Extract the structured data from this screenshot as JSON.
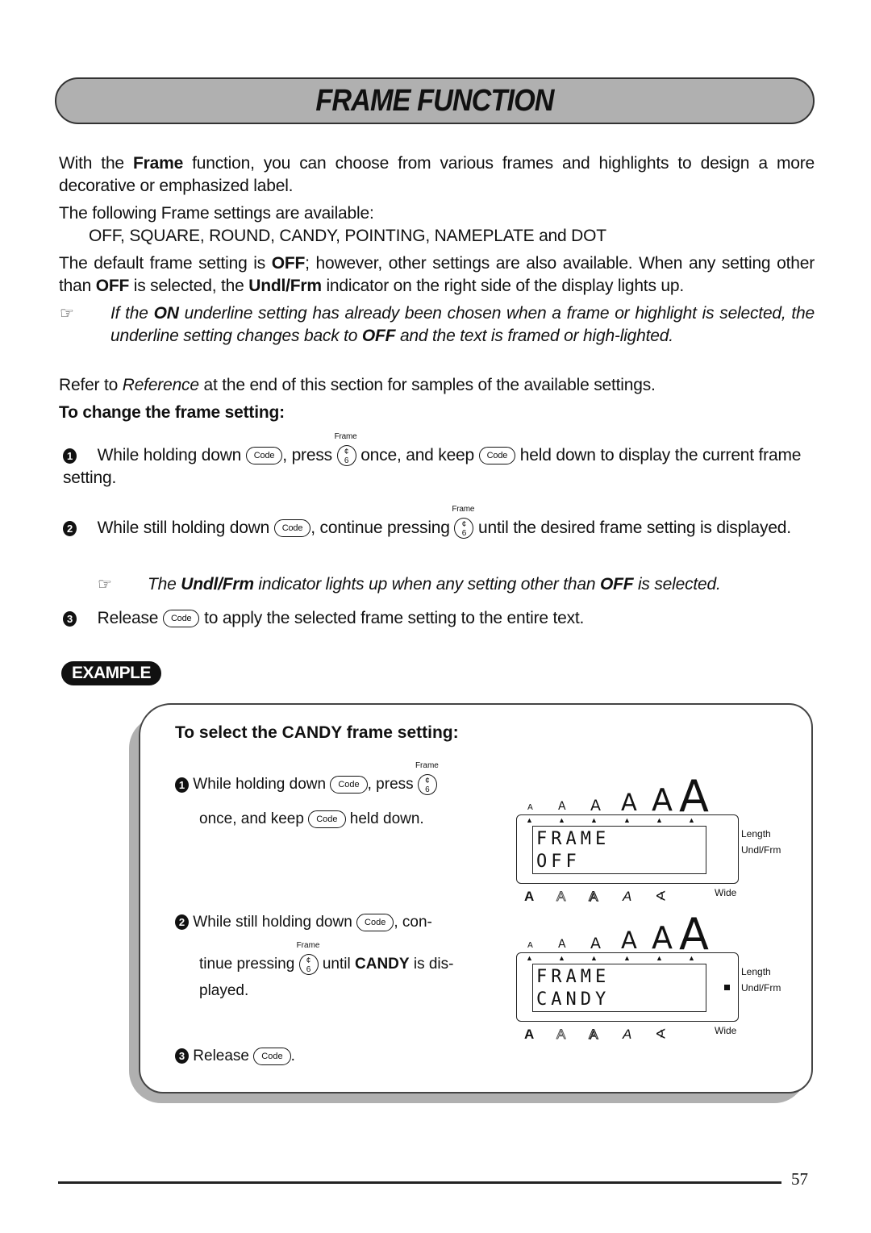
{
  "title": "FRAME FUNCTION",
  "intro": {
    "p1_a": "With the ",
    "p1_bold": "Frame",
    "p1_b": " function, you can choose from various frames and highlights to design a more decorative or emphasized label.",
    "p2": "The following Frame settings are available:",
    "settings_list": "OFF, SQUARE, ROUND, CANDY, POINTING, NAMEPLATE and DOT",
    "p3_a": "The default frame setting is ",
    "p3_off": "OFF",
    "p3_b": "; however, other settings are also available. When any setting other than ",
    "p3_off2": "OFF",
    "p3_c": " is selected, the ",
    "p3_ind": "Undl/Frm",
    "p3_d": " indicator on the right side of the display lights up.",
    "note1_a": "If the ",
    "note1_on": "ON",
    "note1_b": " underline setting has already been chosen when a frame or highlight is selected, the underline setting changes back to ",
    "note1_off": "OFF",
    "note1_c": " and the text is framed or high-lighted.",
    "p4_a": "Refer to ",
    "p4_ref": "Reference",
    "p4_b": " at the end of this section for samples of the available settings."
  },
  "procedure": {
    "heading": "To change the frame setting:",
    "step1": {
      "num": "1",
      "a": "While holding down ",
      "b": ", press ",
      "c": " once, and keep ",
      "d": " held down to display the current frame setting."
    },
    "step2": {
      "num": "2",
      "a": "While still holding down ",
      "b": ", continue pressing ",
      "c": " until the desired frame setting is displayed."
    },
    "note2": {
      "a": "The ",
      "ind": "Undl/Frm",
      "b": " indicator lights up when any setting other than ",
      "off": "OFF",
      "c": " is selected."
    },
    "step3": {
      "num": "3",
      "a": "Release ",
      "b": " to apply the selected frame setting to the entire text."
    }
  },
  "keys": {
    "code": "Code",
    "frame_label": "Frame",
    "frame_top": "¢",
    "frame_bottom": "6"
  },
  "example": {
    "badge": "EXAMPLE",
    "heading": "To select the CANDY frame setting:",
    "step1": {
      "num": "1",
      "a": "While holding down ",
      "b": ", press ",
      "c": "once, and keep ",
      "d": " held down."
    },
    "step2": {
      "num": "2",
      "a": "While still holding down ",
      "b": ", con-",
      "c": "tinue pressing ",
      "d": " until ",
      "candy": "CANDY",
      "e": " is dis-",
      "f": "played."
    },
    "step3": {
      "num": "3",
      "a": "Release ",
      "b": "."
    }
  },
  "displays": [
    {
      "line1": "FRAME",
      "line2": "OFF",
      "undl_frm_on": false
    },
    {
      "line1": "FRAME",
      "line2": "CANDY",
      "undl_frm_on": true
    }
  ],
  "display_labels": {
    "length": "Length",
    "undl_frm": "Undl/Frm",
    "wide": "Wide",
    "size_glyph": "A",
    "tri": "▲",
    "styles": [
      "A",
      "A",
      "A",
      "A",
      "∢"
    ]
  },
  "page_number": "57"
}
